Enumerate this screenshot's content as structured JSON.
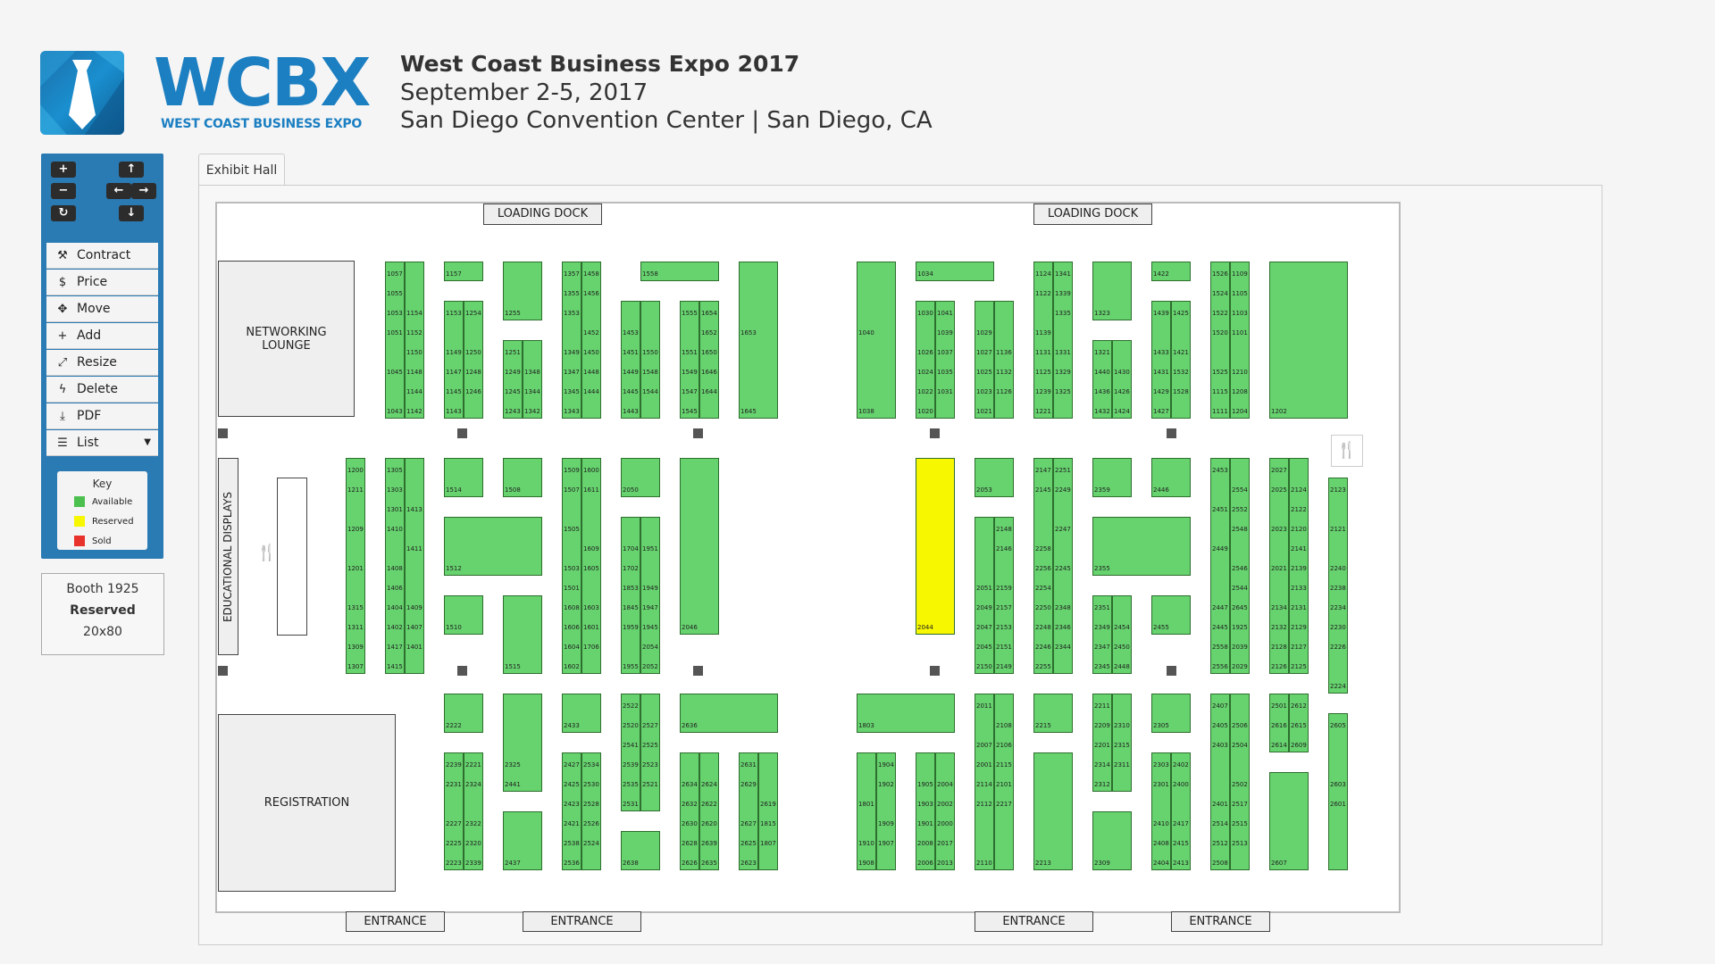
{
  "logo": {
    "text": "WCBX",
    "subtitle": "WEST COAST BUSINESS EXPO"
  },
  "header": {
    "title": "West Coast Business Expo 2017",
    "dates": "September 2-5, 2017",
    "venue": "San Diego Convention Center | San Diego, CA"
  },
  "toolbar": {
    "icons": [
      "plus-icon",
      "arrow-up-icon",
      "minus-icon",
      "arrow-left-icon",
      "arrow-right-icon",
      "refresh-icon",
      "arrow-down-icon"
    ],
    "menu": [
      {
        "label": "Contract",
        "icon": "gavel-icon",
        "glyph": "⚒"
      },
      {
        "label": "Price",
        "icon": "dollar-icon",
        "glyph": "$"
      },
      {
        "label": "Move",
        "icon": "move-icon",
        "glyph": "✥"
      },
      {
        "label": "Add",
        "icon": "plus-icon",
        "glyph": "+"
      },
      {
        "label": "Resize",
        "icon": "resize-icon",
        "glyph": "⤢"
      },
      {
        "label": "Delete",
        "icon": "bolt-icon",
        "glyph": "ϟ"
      },
      {
        "label": "PDF",
        "icon": "download-icon",
        "glyph": "⤓"
      },
      {
        "label": "List",
        "icon": "list-icon",
        "glyph": "☰"
      }
    ],
    "key": {
      "title": "Key",
      "items": [
        {
          "label": "Available",
          "color": "#4cc04f"
        },
        {
          "label": "Reserved",
          "color": "#f7f700"
        },
        {
          "label": "Sold",
          "color": "#e8322c"
        }
      ]
    }
  },
  "booth_info": {
    "booth": "Booth 1925",
    "status": "Reserved",
    "size": "20x80"
  },
  "tab": {
    "label": "Exhibit Hall"
  },
  "map": {
    "loading_docks": [
      "LOADING DOCK",
      "LOADING DOCK"
    ],
    "entrances": [
      "ENTRANCE",
      "ENTRANCE",
      "ENTRANCE",
      "ENTRANCE"
    ],
    "rooms": {
      "networking": "NETWORKING LOUNGE",
      "educational": "EDUCATIONAL DISPLAYS",
      "registration": "REGISTRATION"
    },
    "colors": {
      "available": "#66d36e",
      "reserved": "#f7f700"
    },
    "booths": [
      "1057",
      "1055",
      "1053",
      "1051",
      "1045",
      "1043",
      "1154",
      "1152",
      "1150",
      "1148",
      "1144",
      "1142",
      "1157",
      "1153",
      "1149",
      "1147",
      "1145",
      "1143",
      "1254",
      "1250",
      "1248",
      "1246",
      "1255",
      "1251",
      "1249",
      "1245",
      "1243",
      "1348",
      "1344",
      "1342",
      "1357",
      "1355",
      "1353",
      "1349",
      "1347",
      "1345",
      "1343",
      "1458",
      "1456",
      "1452",
      "1450",
      "1448",
      "1444",
      "1558",
      "1453",
      "1451",
      "1449",
      "1445",
      "1443",
      "1550",
      "1548",
      "1544",
      "1555",
      "1551",
      "1549",
      "1547",
      "1545",
      "1654",
      "1652",
      "1650",
      "1646",
      "1644",
      "1653",
      "1645",
      "1040",
      "1038",
      "1034",
      "1030",
      "1026",
      "1024",
      "1022",
      "1020",
      "1041",
      "1039",
      "1037",
      "1035",
      "1031",
      "1029",
      "1027",
      "1025",
      "1023",
      "1021",
      "1136",
      "1132",
      "1126",
      "1124",
      "1122",
      "1139",
      "1131",
      "1125",
      "1239",
      "1221",
      "1341",
      "1339",
      "1335",
      "1331",
      "1329",
      "1325",
      "1323",
      "1321",
      "1440",
      "1436",
      "1432",
      "1430",
      "1426",
      "1424",
      "1422",
      "1439",
      "1433",
      "1431",
      "1429",
      "1427",
      "1425",
      "1421",
      "1532",
      "1528",
      "1526",
      "1524",
      "1522",
      "1520",
      "1525",
      "1115",
      "1111",
      "1109",
      "1105",
      "1103",
      "1101",
      "1210",
      "1208",
      "1204",
      "1202",
      "1200",
      "1211",
      "1209",
      "1201",
      "1315",
      "1311",
      "1309",
      "1307",
      "1305",
      "1303",
      "1301",
      "1410",
      "1408",
      "1406",
      "1404",
      "1402",
      "1417",
      "1415",
      "1413",
      "1411",
      "1409",
      "1407",
      "1401",
      "1514",
      "1512",
      "1510",
      "1508",
      "1515",
      "1509",
      "1507",
      "1505",
      "1503",
      "1501",
      "1608",
      "1606",
      "1604",
      "1602",
      "1600",
      "1611",
      "1609",
      "1605",
      "1603",
      "1601",
      "1706",
      "1704",
      "1702",
      "1853",
      "1845",
      "1959",
      "1955",
      "1951",
      "1949",
      "1947",
      "1945",
      "2054",
      "2052",
      "2050",
      "2046",
      "2044",
      "2053",
      "2051",
      "2049",
      "2047",
      "2045",
      "2150",
      "2148",
      "2146",
      "2159",
      "2157",
      "2153",
      "2151",
      "2149",
      "2147",
      "2145",
      "2258",
      "2256",
      "2254",
      "2250",
      "2248",
      "2246",
      "2255",
      "2251",
      "2249",
      "2247",
      "2245",
      "2348",
      "2346",
      "2344",
      "2359",
      "2355",
      "2351",
      "2349",
      "2347",
      "2345",
      "2454",
      "2450",
      "2448",
      "2446",
      "2455",
      "2453",
      "2451",
      "2449",
      "2447",
      "2445",
      "2558",
      "2556",
      "2554",
      "2552",
      "2548",
      "2546",
      "2544",
      "2645",
      "1925",
      "2039",
      "2029",
      "2027",
      "2025",
      "2023",
      "2021",
      "2134",
      "2132",
      "2128",
      "2126",
      "2124",
      "2122",
      "2120",
      "2141",
      "2139",
      "2133",
      "2131",
      "2129",
      "2127",
      "2125",
      "2123",
      "2121",
      "2240",
      "2238",
      "2234",
      "2230",
      "2226",
      "2224",
      "2222",
      "2239",
      "2231",
      "2227",
      "2225",
      "2223",
      "2221",
      "2324",
      "2322",
      "2320",
      "2339",
      "2325",
      "2441",
      "2437",
      "2433",
      "2427",
      "2425",
      "2423",
      "2421",
      "2538",
      "2536",
      "2534",
      "2530",
      "2528",
      "2526",
      "2524",
      "2522",
      "2520",
      "2541",
      "2539",
      "2535",
      "2531",
      "2527",
      "2525",
      "2523",
      "2521",
      "2638",
      "2636",
      "2634",
      "2632",
      "2630",
      "2628",
      "2626",
      "2624",
      "2622",
      "2620",
      "2639",
      "2635",
      "2631",
      "2629",
      "2627",
      "2625",
      "2623",
      "2619",
      "1815",
      "1807",
      "1803",
      "1801",
      "1910",
      "1908",
      "1904",
      "1902",
      "1909",
      "1907",
      "1905",
      "1903",
      "1901",
      "2008",
      "2006",
      "2004",
      "2002",
      "2000",
      "2017",
      "2013",
      "2011",
      "2007",
      "2001",
      "2114",
      "2112",
      "2110",
      "2108",
      "2106",
      "2115",
      "2101",
      "2217",
      "2215",
      "2213",
      "2211",
      "2209",
      "2201",
      "2314",
      "2312",
      "2310",
      "2315",
      "2311",
      "2309",
      "2305",
      "2303",
      "2301",
      "2410",
      "2408",
      "2404",
      "2402",
      "2400",
      "2417",
      "2415",
      "2413",
      "2407",
      "2405",
      "2403",
      "2401",
      "2514",
      "2512",
      "2508",
      "2506",
      "2504",
      "2502",
      "2517",
      "2515",
      "2513",
      "2501",
      "2616",
      "2614",
      "2612",
      "2615",
      "2609",
      "2607",
      "2605",
      "2603",
      "2601"
    ]
  }
}
